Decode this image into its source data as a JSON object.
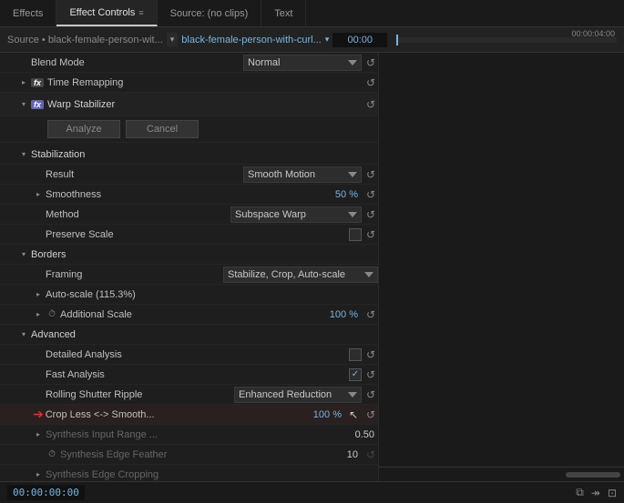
{
  "tabs": [
    {
      "id": "effects",
      "label": "Effects",
      "active": false
    },
    {
      "id": "effect-controls",
      "label": "Effect Controls",
      "active": true,
      "has_menu": true
    },
    {
      "id": "source",
      "label": "Source: (no clips)",
      "active": false
    },
    {
      "id": "text",
      "label": "Text",
      "active": false
    }
  ],
  "source_bar": {
    "source_label": "Source • black-female-person-wit...",
    "clip_label": "black-female-person-with-curl...",
    "timecode_start": "00:00",
    "timecode_end": "00:00:04:00"
  },
  "blend_mode": {
    "label": "Blend Mode",
    "value": "Normal"
  },
  "time_remapping": {
    "label": "Time Remapping"
  },
  "warp_stabilizer": {
    "label": "Warp Stabilizer"
  },
  "analyze_btn": "Analyze",
  "cancel_btn": "Cancel",
  "sections": {
    "stabilization": {
      "label": "Stabilization",
      "result_label": "Result",
      "result_value": "Smooth Motion",
      "smoothness_label": "Smoothness",
      "smoothness_value": "50 %",
      "method_label": "Method",
      "method_value": "Subspace Warp",
      "preserve_scale_label": "Preserve Scale"
    },
    "borders": {
      "label": "Borders",
      "framing_label": "Framing",
      "framing_value": "Stabilize, Crop, Auto-scale",
      "autoscale_label": "Auto-scale (115.3%)",
      "additional_scale_label": "Additional Scale",
      "additional_scale_value": "100 %"
    },
    "advanced": {
      "label": "Advanced",
      "detailed_analysis_label": "Detailed Analysis",
      "fast_analysis_label": "Fast Analysis",
      "rolling_shutter_label": "Rolling Shutter Ripple",
      "rolling_shutter_value": "Enhanced Reduction",
      "crop_smooth_label": "Crop Less <-> Smooth...",
      "crop_smooth_value": "100 %",
      "synthesis_input_label": "Synthesis Input Range ...",
      "synthesis_input_value": "0.50",
      "synthesis_feather_label": "Synthesis Edge Feather",
      "synthesis_feather_value": "10",
      "synthesis_cropping_label": "Synthesis Edge Cropping"
    }
  },
  "bottom": {
    "timecode": "00:00:00:00"
  },
  "icons": {
    "reset": "↺",
    "collapse_open": "▾",
    "collapse_closed": "▸",
    "dropdown": "▾",
    "filter": "⧉",
    "settings": "≡",
    "red_arrow": "➔"
  }
}
